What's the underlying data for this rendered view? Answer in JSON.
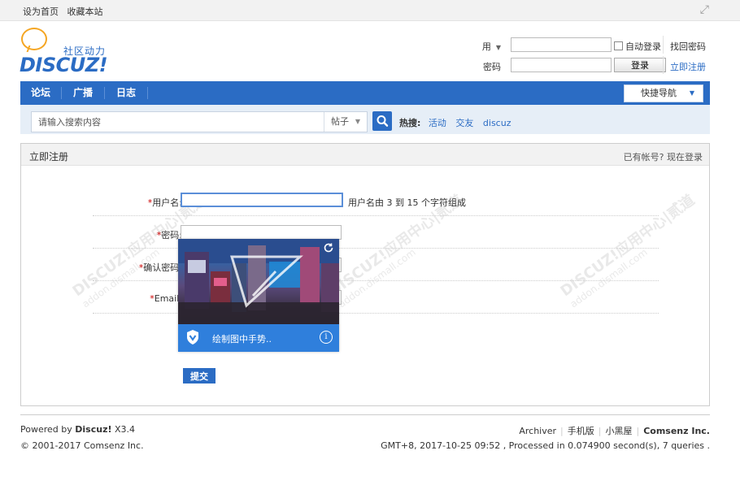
{
  "topbar": {
    "set_home": "设为首页",
    "bookmark": "收藏本站"
  },
  "logo": {
    "slogan": "社区动力",
    "wordmark": "DISCUZ!"
  },
  "login": {
    "user_label": "用",
    "password_label": "密码",
    "auto_login": "自动登录",
    "find_password": "找回密码",
    "login_button": "登录",
    "register": "立即注册"
  },
  "nav": {
    "items": [
      "论坛",
      "广播",
      "日志"
    ],
    "quick_nav": "快捷导航"
  },
  "search": {
    "placeholder": "请输入搜索内容",
    "type_selected": "帖子",
    "hot_label": "热搜:",
    "hot_terms": [
      "活动",
      "交友",
      "discuz"
    ]
  },
  "register": {
    "title": "立即注册",
    "have_account": "已有帐号? 现在登录",
    "fields": [
      {
        "label": "用户名:",
        "tip": "用户名由 3 到 15 个字符组成"
      },
      {
        "label": "密码:"
      },
      {
        "label": "确认密码:"
      },
      {
        "label": "Email:"
      }
    ],
    "submit": "提交"
  },
  "captcha": {
    "instruction": "绘制图中手势.."
  },
  "watermark": {
    "text": "DISCUZ!应用中心|贰道",
    "url": "addon.dismall.com"
  },
  "footer": {
    "powered_prefix": "Powered by",
    "product": "Discuz!",
    "version": "X3.4",
    "copyright": "© 2001-2017 Comsenz Inc.",
    "links": [
      "Archiver",
      "手机版",
      "小黑屋"
    ],
    "company": "Comsenz Inc.",
    "stats": "GMT+8, 2017-10-25 09:52 , Processed in 0.074900 second(s), 7 queries ."
  },
  "colors": {
    "brand_blue": "#2b6cc4",
    "required_star": "#cc0000",
    "captcha_bar": "#2f7fdc"
  }
}
